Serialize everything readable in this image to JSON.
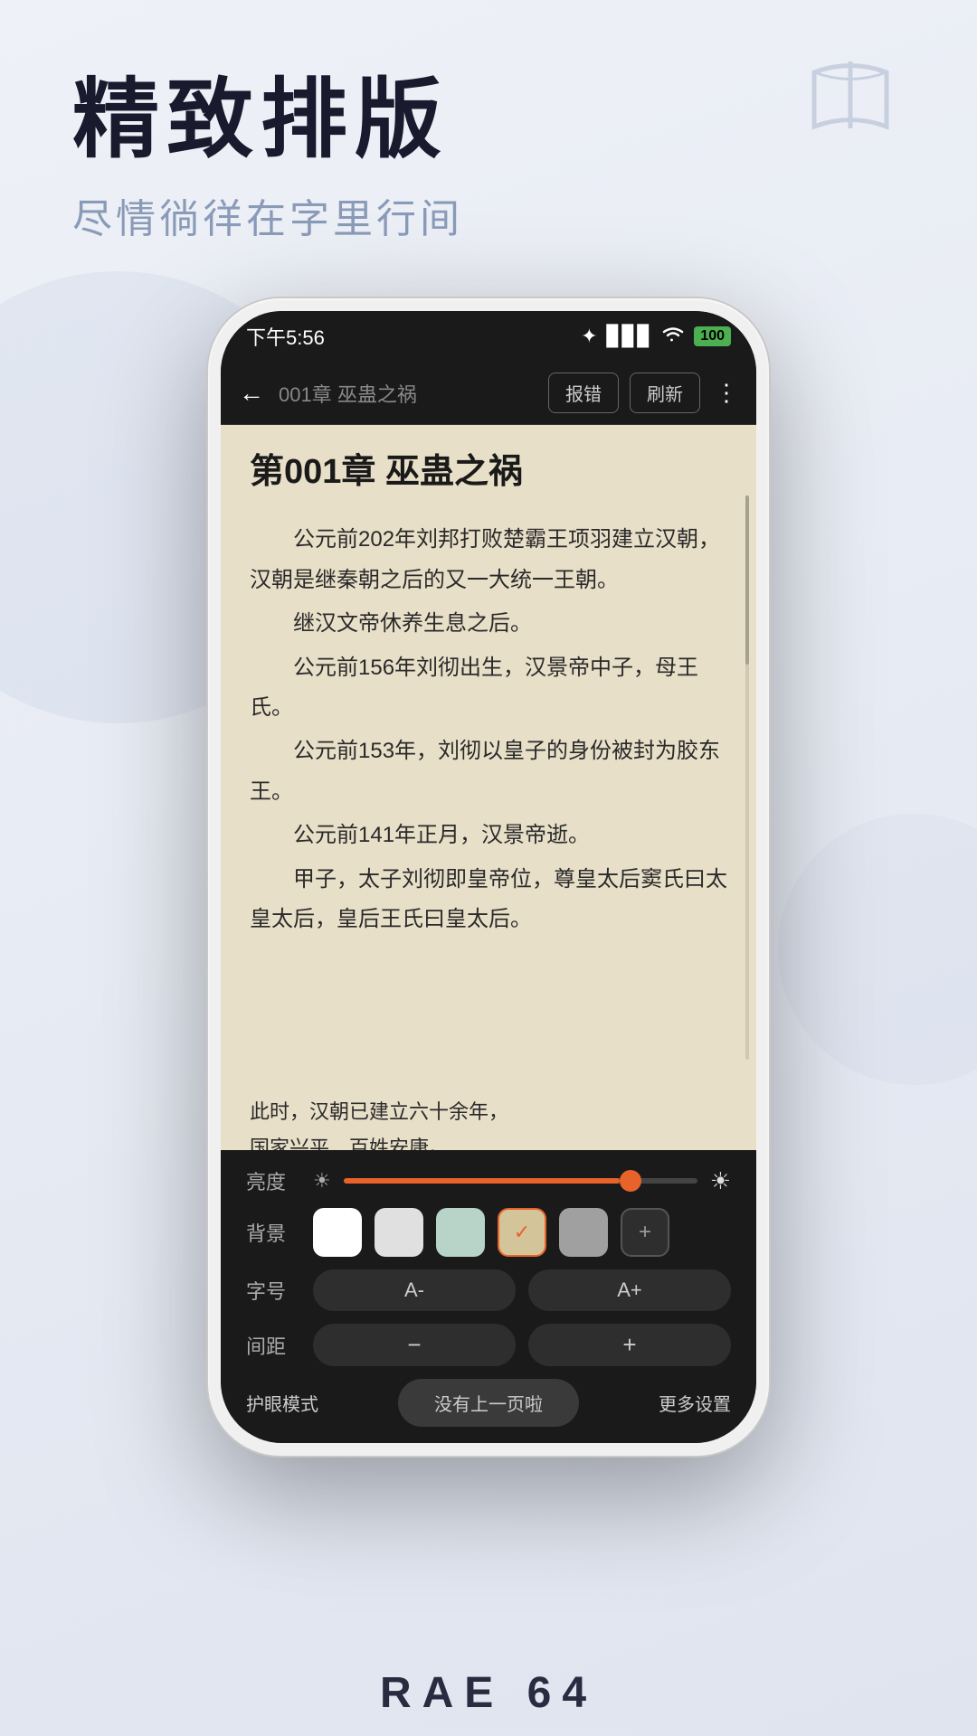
{
  "app": {
    "background": "#eef1f7"
  },
  "header": {
    "main_title": "精致排版",
    "sub_title": "尽情徜徉在字里行间"
  },
  "status_bar": {
    "time": "下午5:56",
    "icons": "✦ ⊘",
    "bluetooth": "✦",
    "signal": "▋▋▋",
    "wifi": "WiFi",
    "battery": "100"
  },
  "navbar": {
    "back_label": "←",
    "title": "001章 巫蛊之祸",
    "report_btn": "报错",
    "refresh_btn": "刷新",
    "more_icon": "⋮"
  },
  "book": {
    "chapter_title": "第001章 巫蛊之祸",
    "paragraphs": [
      "公元前202年刘邦打败楚霸王项羽建立汉朝，汉朝是继秦朝之后的又一大统一王朝。",
      "继汉文帝休养生息之后。",
      "公元前156年刘彻出生，汉景帝中子，母王氏。",
      "公元前153年，刘彻以皇子的身份被封为胶东王。",
      "公元前141年正月，汉景帝逝。",
      "甲子，太子刘彻即皇帝位，尊皇太后窦氏曰太皇太后，皇后王氏曰皇太后。"
    ],
    "overlay_text": "此时，汉朝已建立六十余年，国家兴平，百姓安康。"
  },
  "settings": {
    "brightness_label": "亮度",
    "brightness_value": 78,
    "bg_label": "背景",
    "bg_colors": [
      "#ffffff",
      "#e8e8e8",
      "#c8e0d8",
      "#e8dfc8",
      "#b0b0b0"
    ],
    "bg_selected_index": 3,
    "font_label": "字号",
    "font_decrease": "A-",
    "font_increase": "A+",
    "spacing_label": "间距",
    "spacing_decrease": "−",
    "spacing_increase": "+",
    "eye_mode_btn": "护眼模式",
    "no_prev_btn": "没有上一页啦",
    "more_settings_btn": "更多设置"
  },
  "bottom_watermark": "RAE  64"
}
